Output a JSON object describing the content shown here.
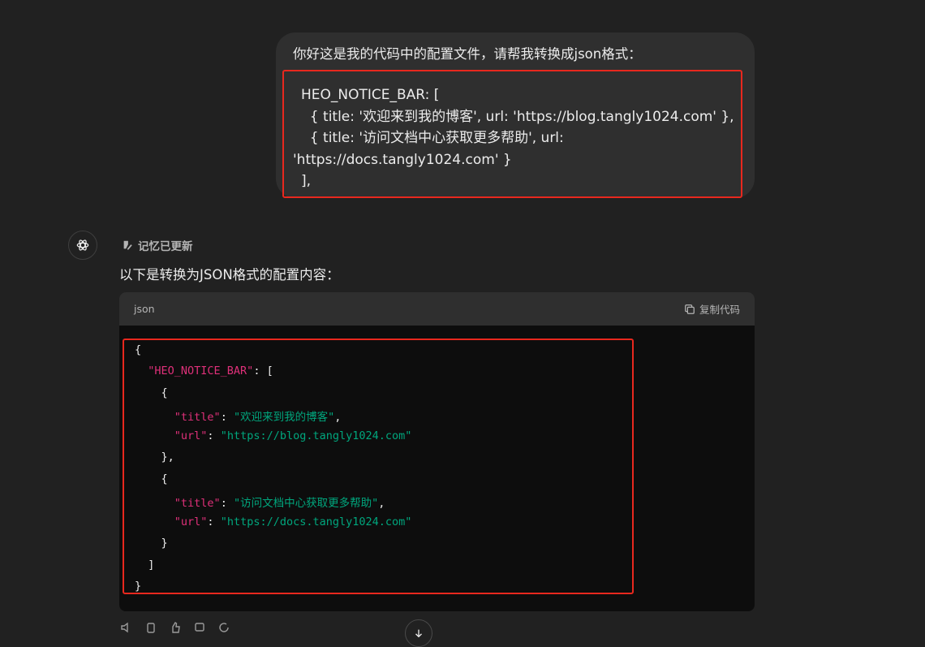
{
  "user_message": {
    "intro": "你好这是我的代码中的配置文件，请帮我转换成json格式：",
    "code_lines": [
      "HEO_NOTICE_BAR: [",
      "  { title: '欢迎来到我的博客', url: 'https://blog.tangly1024.com' },",
      "  { title: '访问文档中心获取更多帮助', url:",
      "'https://docs.tangly1024.com' }",
      "],"
    ]
  },
  "assistant": {
    "memory_label": "记忆已更新",
    "intro": "以下是转换为JSON格式的配置内容：",
    "code_block": {
      "language": "json",
      "copy_label": "复制代码",
      "lines": {
        "l0": "{",
        "l1_key": "\"HEO_NOTICE_BAR\"",
        "l1_rest": ": [",
        "l2": "{",
        "l3_key": "\"title\"",
        "l3_val": "\"欢迎来到我的博客\"",
        "l4_key": "\"url\"",
        "l4_val": "\"https://blog.tangly1024.com\"",
        "l5": "},",
        "l6": "{",
        "l7_key": "\"title\"",
        "l7_val": "\"访问文档中心获取更多帮助\"",
        "l8_key": "\"url\"",
        "l8_val": "\"https://docs.tangly1024.com\"",
        "l9": "}",
        "l10": "]",
        "l11": "}"
      }
    }
  },
  "colors": {
    "background": "#212121",
    "bubble": "#2f2f2f",
    "code_background": "#0d0d0d",
    "json_key": "#df3079",
    "json_string": "#00a67d",
    "highlight_box": "#e8281e"
  },
  "icons": [
    "openai-logo-icon",
    "memory-pencil-icon",
    "copy-icon",
    "speaker-icon",
    "clipboard-icon",
    "thumbs-up-icon",
    "thumbs-down-icon",
    "regenerate-icon",
    "scroll-down-icon"
  ]
}
